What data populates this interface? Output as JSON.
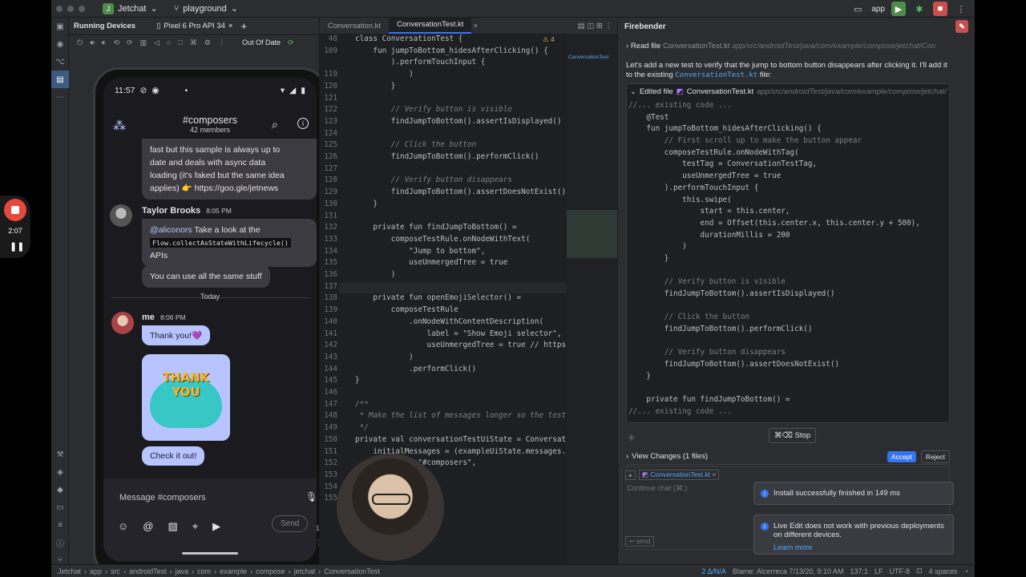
{
  "titlebar": {
    "project": "Jetchat",
    "project_badge": "J",
    "branch": "playground",
    "run_config": "app"
  },
  "running_devices": {
    "panel_title": "Running Devices",
    "device_tab": "Pixel 6 Pro API 34",
    "out_of_date": "Out Of Date"
  },
  "phone": {
    "time": "11:57",
    "channel": "#composers",
    "members": "42 members",
    "msg1_lines": [
      "fast but this sample is always up to",
      "date and deals with async data",
      "loading (it's faked but the same idea",
      "applies) 👉 https://goo.gle/jetnews"
    ],
    "msg1_link": "https://goo.gle/jetnews",
    "author2": "Taylor Brooks",
    "time2": "8:05 PM",
    "mention": "@aliconors",
    "msg2a": "Take a look at the",
    "msg2code": "Flow.collectAsStateWithLifecycle()",
    "msg2b": "APIs",
    "msg3": "You can use all the same stuff",
    "divider": "Today",
    "author_me": "me",
    "time_me": "8:06 PM",
    "msg_me1": "Thank you!💜",
    "sticker_text": "THANK YOU",
    "msg_me2": "Check it out!",
    "input_placeholder": "Message #composers",
    "send": "Send"
  },
  "recording": {
    "elapsed": "2:07"
  },
  "editor": {
    "tabs": [
      "Conversation.kt",
      "ConversationTest.kt"
    ],
    "active_tab": "ConversationTest.kt",
    "warnings": "⚠ 4",
    "lines": [
      {
        "n": "48",
        "t": "class ConversationTest {"
      },
      {
        "n": "109",
        "t": "    fun jumpToBottom_hidesAfterClicking() {"
      },
      {
        "n": "",
        "t": "        ).performTouchInput {"
      },
      {
        "n": "119",
        "t": "            )"
      },
      {
        "n": "120",
        "t": "        }"
      },
      {
        "n": "121",
        "t": ""
      },
      {
        "n": "122",
        "t": "        // Verify button is visible"
      },
      {
        "n": "123",
        "t": "        findJumpToBottom().assertIsDisplayed()"
      },
      {
        "n": "124",
        "t": ""
      },
      {
        "n": "125",
        "t": "        // Click the button"
      },
      {
        "n": "126",
        "t": "        findJumpToBottom().performClick()"
      },
      {
        "n": "127",
        "t": ""
      },
      {
        "n": "128",
        "t": "        // Verify button disappears"
      },
      {
        "n": "129",
        "t": "        findJumpToBottom().assertDoesNotExist()"
      },
      {
        "n": "130",
        "t": "    }"
      },
      {
        "n": "131",
        "t": ""
      },
      {
        "n": "132",
        "t": "    private fun findJumpToBottom() ="
      },
      {
        "n": "133",
        "t": "        composeTestRule.onNodeWithText("
      },
      {
        "n": "134",
        "t": "            \"Jump to bottom\","
      },
      {
        "n": "135",
        "t": "            useUnmergedTree = true"
      },
      {
        "n": "136",
        "t": "        )"
      },
      {
        "n": "137",
        "t": ""
      },
      {
        "n": "138",
        "t": "    private fun openEmojiSelector() ="
      },
      {
        "n": "139",
        "t": "        composeTestRule"
      },
      {
        "n": "140",
        "t": "            .onNodeWithContentDescription("
      },
      {
        "n": "141",
        "t": "                label = \"Show Emoji selector\","
      },
      {
        "n": "142",
        "t": "                useUnmergedTree = true // https://i"
      },
      {
        "n": "143",
        "t": "            )"
      },
      {
        "n": "144",
        "t": "            .performClick()"
      },
      {
        "n": "145",
        "t": "}"
      },
      {
        "n": "146",
        "t": ""
      },
      {
        "n": "147",
        "t": "/**"
      },
      {
        "n": "148",
        "t": " * Make the list of messages longer so the test mak"
      },
      {
        "n": "149",
        "t": " */"
      },
      {
        "n": "150",
        "t": "private val conversationTestUiState = Conversation"
      },
      {
        "n": "151",
        "t": "    initialMessages = (exampleUiState.messages.plus"
      },
      {
        "n": "152",
        "t": "            = \"#composers\","
      },
      {
        "n": "153",
        "t": "            = 42"
      },
      {
        "n": "154",
        "t": ""
      },
      {
        "n": "155",
        "t": ""
      }
    ]
  },
  "firebender": {
    "title": "Firebender",
    "read_label": "Read file",
    "read_file": "ConversationTest.kt",
    "read_path": "app/src/androidTest/java/com/example/compose/jetchat/Con",
    "msg": "Let's add a new test to verify that the jump to bottom button disappears after clicking it. I'll add it to the existing",
    "msg_file": "ConversationTest.kt",
    "msg_end": "file:",
    "edited_label": "Edited file",
    "edited_file": "ConversationTest.kt",
    "edited_path": "app/src/androidTest/java/com/example/compose/jetchat/",
    "code": [
      "//... existing code ...",
      "    @Test",
      "    fun jumpToBottom_hidesAfterClicking() {",
      "        // First scroll up to make the button appear",
      "        composeTestRule.onNodeWithTag(",
      "            testTag = ConversationTestTag,",
      "            useUnmergedTree = true",
      "        ).performTouchInput {",
      "            this.swipe(",
      "                start = this.center,",
      "                end = Offset(this.center.x, this.center.y + 500),",
      "                durationMillis = 200",
      "            )",
      "        }",
      "",
      "        // Verify button is visible",
      "        findJumpToBottom().assertIsDisplayed()",
      "",
      "        // Click the button",
      "        findJumpToBottom().performClick()",
      "",
      "        // Verify button disappears",
      "        findJumpToBottom().assertDoesNotExist()",
      "    }",
      "",
      "    private fun findJumpToBottom() =",
      "//... existing code ..."
    ],
    "stop": "⌘⌫ Stop",
    "view_changes": "View Changes (1 files)",
    "accept": "Accept",
    "reject": "Reject",
    "chip": "ConversationTest.kt",
    "continue": "Continue chat (⌘;)",
    "send": "↩ send"
  },
  "toasts": {
    "install": "Install successfully finished in 149 ms",
    "live_edit": "Live Edit does not work with previous deployments on different devices.",
    "learn_more": "Learn more"
  },
  "statusbar": {
    "crumbs": [
      "Jetchat",
      "app",
      "src",
      "androidTest",
      "java",
      "com",
      "example",
      "compose",
      "jetchat",
      "ConversationTest"
    ],
    "problems": "2 Δ/N/A",
    "blame": "Blame: Alcerreca 7/13/20, 9:10 AM",
    "pos": "137:1",
    "lf": "LF",
    "enc": "UTF-8",
    "indent": "4 spaces"
  }
}
